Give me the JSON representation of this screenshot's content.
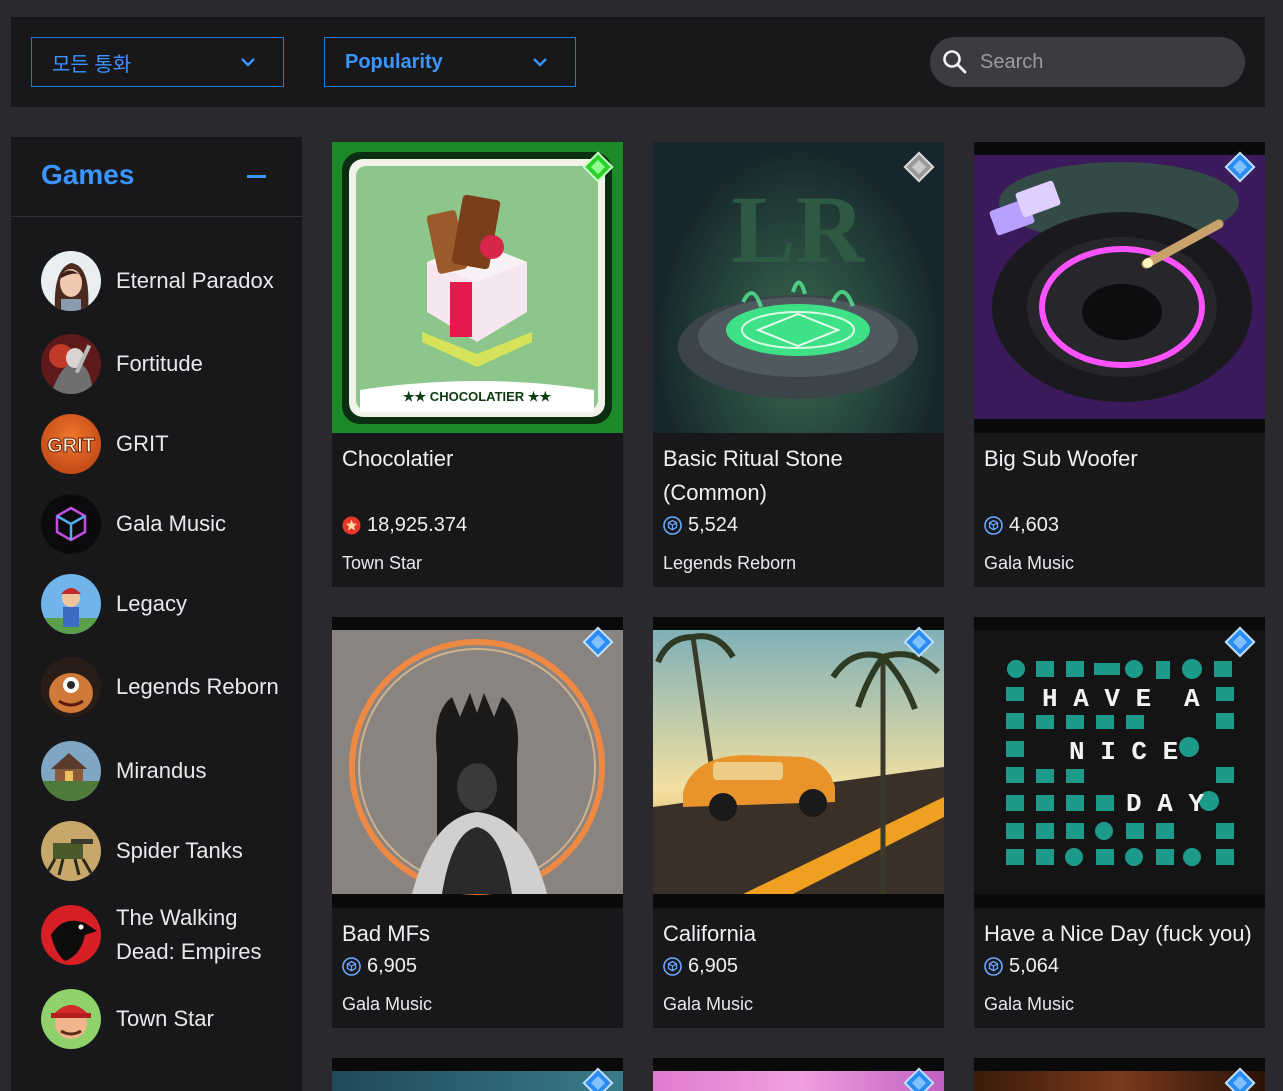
{
  "toolbar": {
    "currency_filter": "모든 통화",
    "sort_filter": "Popularity",
    "search_placeholder": "Search"
  },
  "sidebar": {
    "title": "Games",
    "items": [
      {
        "label": "Eternal Paradox"
      },
      {
        "label": "Fortitude"
      },
      {
        "label": "GRIT",
        "logo_text": "GRIT"
      },
      {
        "label": "Gala Music"
      },
      {
        "label": "Legacy"
      },
      {
        "label": "Legends Reborn"
      },
      {
        "label": "Mirandus"
      },
      {
        "label": "Spider Tanks"
      },
      {
        "label": "The Walking Dead: Empires"
      },
      {
        "label": "Town Star"
      }
    ]
  },
  "cards": [
    {
      "title": "Chocolatier",
      "price": "18,925.374",
      "currency_icon": "townstar-coin-icon",
      "game": "Town Star",
      "rarity_color": "#2bd12b",
      "banner": "★★ CHOCOLATIER ★★"
    },
    {
      "title": "Basic Ritual Stone (Common)",
      "price": "5,524",
      "currency_icon": "gala-coin-icon",
      "game": "Legends Reborn",
      "rarity_color": "#9a9a9a",
      "logo_text": "LR"
    },
    {
      "title": "Big Sub Woofer",
      "price": "4,603",
      "currency_icon": "gala-coin-icon",
      "game": "Gala Music",
      "rarity_color": "#2a8cf0"
    },
    {
      "title": "Bad MFs",
      "price": "6,905",
      "currency_icon": "gala-coin-icon",
      "game": "Gala Music",
      "rarity_color": "#2a8cf0"
    },
    {
      "title": "California",
      "price": "6,905",
      "currency_icon": "gala-coin-icon",
      "game": "Gala Music",
      "rarity_color": "#2a8cf0"
    },
    {
      "title": "Have a Nice Day (fuck you)",
      "price": "5,064",
      "currency_icon": "gala-coin-icon",
      "game": "Gala Music",
      "rarity_color": "#2a8cf0",
      "art_text": [
        "H A V E",
        "A",
        "N I C E",
        "D A Y"
      ]
    },
    {
      "rarity_color": "#2a8cf0"
    },
    {
      "rarity_color": "#2a8cf0"
    },
    {
      "rarity_color": "#2a8cf0"
    }
  ]
}
